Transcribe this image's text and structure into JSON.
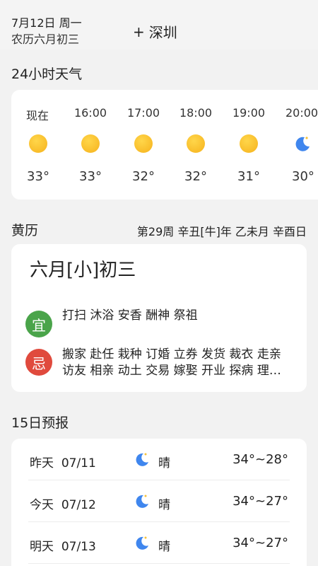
{
  "header": {
    "date": "7月12日 周一",
    "lunar": "农历六月初三",
    "city": "深圳",
    "add_icon": "plus-icon"
  },
  "hourly": {
    "title": "24小时天气",
    "items": [
      {
        "time": "现在",
        "icon": "sun-icon",
        "temp": "33°"
      },
      {
        "time": "16:00",
        "icon": "sun-icon",
        "temp": "33°"
      },
      {
        "time": "17:00",
        "icon": "sun-icon",
        "temp": "32°"
      },
      {
        "time": "18:00",
        "icon": "sun-icon",
        "temp": "32°"
      },
      {
        "time": "19:00",
        "icon": "sun-icon",
        "temp": "31°"
      },
      {
        "time": "20:00",
        "icon": "moon-icon",
        "temp": "30°"
      }
    ]
  },
  "almanac": {
    "title": "黄历",
    "info": "第29周 辛丑[牛]年 乙未月 辛酉日",
    "lunar_date": "六月[小]初三",
    "yi_label": "宜",
    "yi_items": "打扫 沐浴 安香 酬神 祭祖",
    "ji_label": "忌",
    "ji_items": "搬家 赴任 栽种 订婚 立券 发货 裁衣 走亲 访友 相亲 动土 交易 嫁娶 开业 探病 理…"
  },
  "forecast": {
    "title": "15日预报",
    "days": [
      {
        "day": "昨天",
        "date": "07/11",
        "icon": "moon-icon",
        "condition": "晴",
        "temp": "34°~28°"
      },
      {
        "day": "今天",
        "date": "07/12",
        "icon": "moon-icon",
        "condition": "晴",
        "temp": "34°~27°"
      },
      {
        "day": "明天",
        "date": "07/13",
        "icon": "moon-icon",
        "condition": "晴",
        "temp": "34°~27°"
      }
    ]
  },
  "colors": {
    "sun": "#f6b21c",
    "moon": "#3f86ee",
    "yi": "#4aa44a",
    "ji": "#e04a3d"
  }
}
